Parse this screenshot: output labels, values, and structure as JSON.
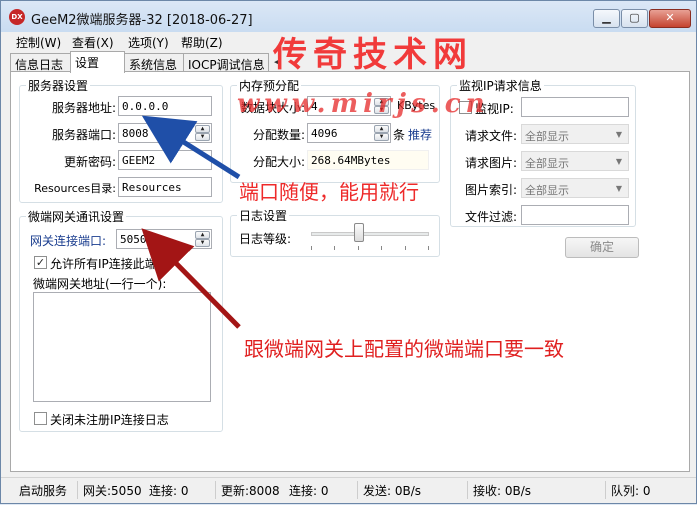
{
  "window": {
    "title": "GeeM2微端服务器-32 [2018-06-27]",
    "icon_text": "DX",
    "buttons": {
      "minimize": "▁",
      "maximize": "▢",
      "close": "✕"
    }
  },
  "menu": [
    "控制(W)",
    "查看(X)",
    "选项(Y)",
    "帮助(Z)"
  ],
  "tabs": [
    "信息日志",
    "设置",
    "系统信息",
    "IOCP调试信息"
  ],
  "tabs_more": "◂",
  "server_settings": {
    "title": "服务器设置",
    "address_label": "服务器地址:",
    "address_value": "0.0.0.0",
    "port_label": "服务器端口:",
    "port_value": "8008",
    "password_label": "更新密码:",
    "password_value": "GEEM2",
    "resources_label": "Resources目录:",
    "resources_value": "Resources"
  },
  "gateway_settings": {
    "title": "微端网关通讯设置",
    "port_label": "网关连接端口:",
    "port_value": "5050",
    "allow_all_label": "允许所有IP连接此端口",
    "allow_all_checked": true,
    "address_label": "微端网关地址(一行一个):",
    "close_unregistered_label": "关闭未注册IP连接日志",
    "close_unregistered_checked": false
  },
  "memory": {
    "title": "内存预分配",
    "block_size_label": "数据块大小:",
    "block_size_value": "4",
    "block_size_unit": "KBytes",
    "count_label": "分配数量:",
    "count_value": "4096",
    "count_unit": "条",
    "recommend_label": "推荐",
    "total_label": "分配大小:",
    "total_value": "268.64MBytes"
  },
  "log_settings": {
    "title": "日志设置",
    "level_label": "日志等级:",
    "level_fraction": 0.4
  },
  "monitor": {
    "title": "监视IP请求信息",
    "ip_label": "监视IP:",
    "ip_checked": false,
    "ip_value": "",
    "file_label": "请求文件:",
    "file_value": "全部显示",
    "image_label": "请求图片:",
    "image_value": "全部显示",
    "index_label": "图片索引:",
    "index_value": "全部显示",
    "filter_label": "文件过滤:",
    "filter_value": "",
    "ok_button": "确定"
  },
  "status": {
    "start": "启动服务",
    "gateway_label": "网关:5050",
    "gateway_conn": "连接: 0",
    "update_label": "更新:8008",
    "update_conn": "连接: 0",
    "send": "发送: 0B/s",
    "recv": "接收: 0B/s",
    "queue": "队列: 0"
  },
  "watermark": {
    "title": "传奇技术网",
    "url": "www.mirjs.cn"
  },
  "annotations": {
    "port_note": "端口随便，能用就行",
    "gateway_note": "跟微端网关上配置的微端端口要一致",
    "arrow_blue": "#1f4fa8",
    "arrow_red": "#a31515"
  }
}
